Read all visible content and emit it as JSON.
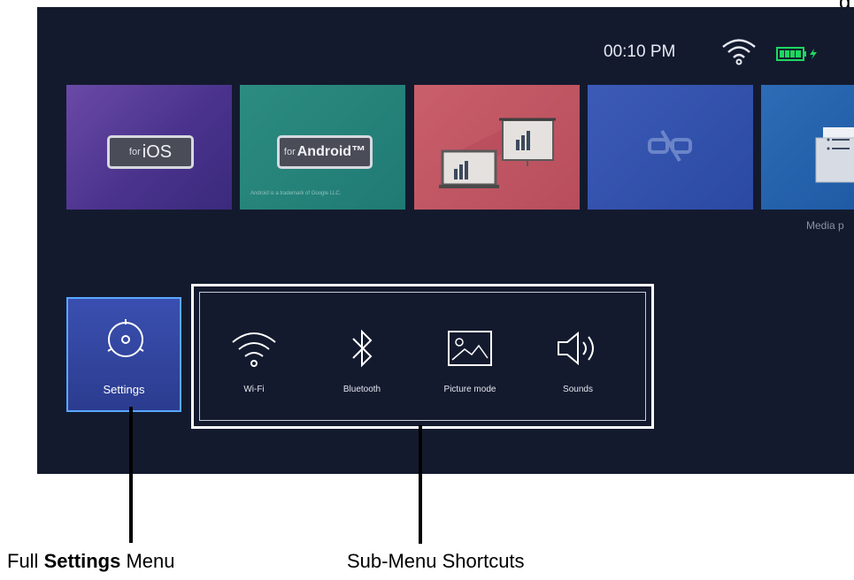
{
  "status_bar": {
    "time": "00:10 PM",
    "wifi_icon": "wifi-icon",
    "battery_icon": "battery-charging-icon",
    "battery_color": "#1ed760"
  },
  "app_tiles": [
    {
      "small": "for",
      "big": "iOS"
    },
    {
      "small": "for",
      "big": "Android™",
      "note": "Android is a trademark of Google LLC."
    },
    {
      "icon": "presentation-icon"
    },
    {
      "icon": "cast-off-icon"
    },
    {
      "icon": "folder-icon",
      "caption": "Media p"
    }
  ],
  "settings": {
    "label": "Settings",
    "icon": "settings-dial-icon",
    "accent": "#58a8ff"
  },
  "shortcuts": [
    {
      "label": "Wi-Fi",
      "icon": "wifi-icon"
    },
    {
      "label": "Bluetooth",
      "icon": "bluetooth-icon"
    },
    {
      "label": "Picture mode",
      "icon": "picture-icon"
    },
    {
      "label": "Sounds",
      "icon": "speaker-icon"
    }
  ],
  "callouts": {
    "settings_prefix": "Full ",
    "settings_bold": "Settings",
    "settings_suffix": " Menu",
    "shortcuts": "Sub-Menu Shortcuts"
  },
  "corner_text": "g"
}
